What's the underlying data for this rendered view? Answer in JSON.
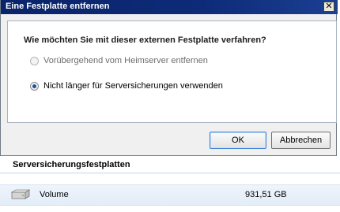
{
  "dialog": {
    "title": "Eine Festplatte entfernen",
    "close_label": "✕",
    "question": "Wie möchten Sie mit dieser externen Festplatte verfahren?",
    "options": [
      {
        "label": "Vorübergehend vom Heimserver entfernen",
        "selected": false,
        "enabled": false
      },
      {
        "label": "Nicht länger für Serversicherungen verwenden",
        "selected": true,
        "enabled": true
      }
    ],
    "ok_label": "OK",
    "cancel_label": "Abbrechen"
  },
  "background": {
    "section_title": "Serversicherungsfestplatten",
    "rows": [
      {
        "icon": "hard-drive-icon",
        "name": "Volume",
        "size": "931,51 GB"
      }
    ]
  }
}
